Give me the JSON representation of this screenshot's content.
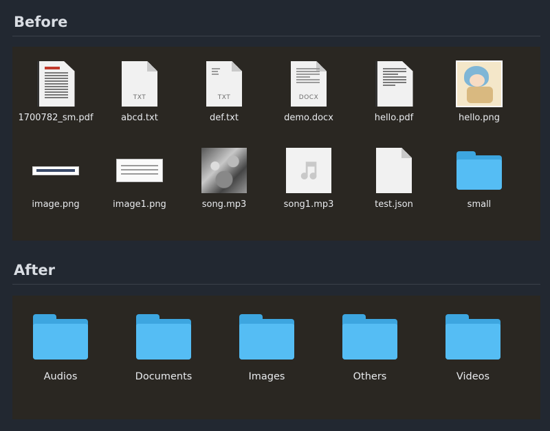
{
  "before": {
    "title": "Before",
    "items": [
      {
        "label": "1700782_sm.pdf",
        "icon": "pdf-document-icon"
      },
      {
        "label": "abcd.txt",
        "icon": "text-file-icon",
        "ext": "TXT"
      },
      {
        "label": "def.txt",
        "icon": "text-file-icon",
        "ext": "TXT"
      },
      {
        "label": "demo.docx",
        "icon": "docx-file-icon",
        "ext": "DOCX"
      },
      {
        "label": "hello.pdf",
        "icon": "pdf-document-icon"
      },
      {
        "label": "hello.png",
        "icon": "image-thumbnail-icon"
      },
      {
        "label": "image.png",
        "icon": "image-thumbnail-icon"
      },
      {
        "label": "image1.png",
        "icon": "image-thumbnail-icon"
      },
      {
        "label": "song.mp3",
        "icon": "album-art-icon"
      },
      {
        "label": "song1.mp3",
        "icon": "music-note-icon"
      },
      {
        "label": "test.json",
        "icon": "blank-file-icon"
      },
      {
        "label": "small",
        "icon": "folder-icon"
      }
    ]
  },
  "after": {
    "title": "After",
    "items": [
      {
        "label": "Audios",
        "icon": "folder-icon"
      },
      {
        "label": "Documents",
        "icon": "folder-icon"
      },
      {
        "label": "Images",
        "icon": "folder-icon"
      },
      {
        "label": "Others",
        "icon": "folder-icon"
      },
      {
        "label": "Videos",
        "icon": "folder-icon"
      }
    ]
  },
  "colors": {
    "background": "#222831",
    "panel": "#2a2722",
    "folder": "#55bdf4"
  }
}
